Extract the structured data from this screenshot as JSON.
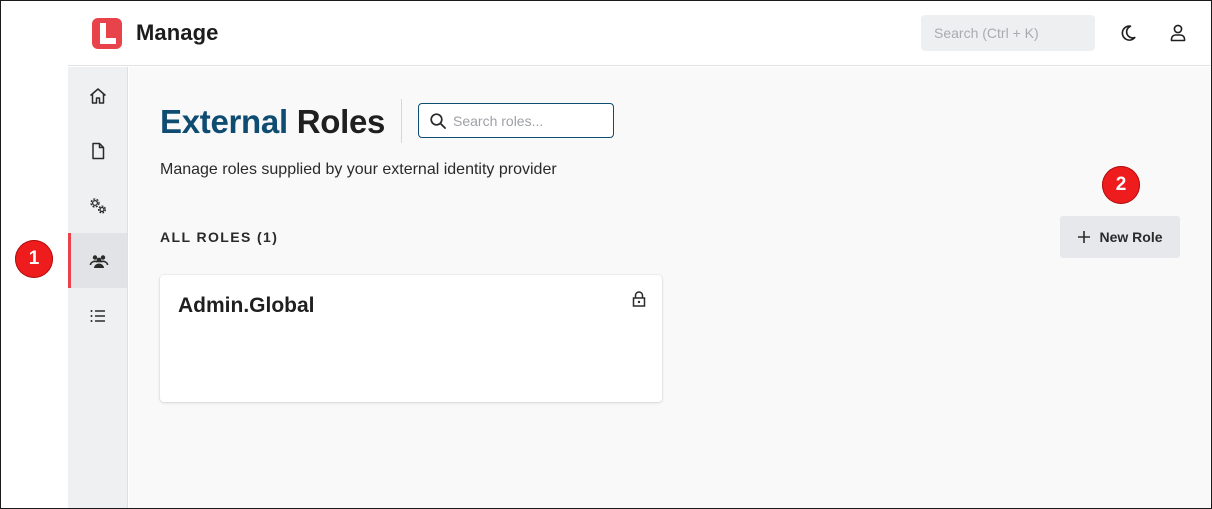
{
  "header": {
    "app_title": "Manage",
    "search_placeholder": "Search (Ctrl + K)"
  },
  "sidebar": {
    "items": [
      {
        "icon": "home-icon"
      },
      {
        "icon": "document-icon"
      },
      {
        "icon": "settings-gears-icon"
      },
      {
        "icon": "users-icon",
        "active": true
      },
      {
        "icon": "list-icon"
      }
    ]
  },
  "main": {
    "title_accent": "External",
    "title_rest": "Roles",
    "search_placeholder": "Search roles...",
    "subtitle": "Manage roles supplied by your external identity provider",
    "section_label": "ALL ROLES (1)",
    "new_role_label": "New Role",
    "roles": [
      {
        "name": "Admin.Global",
        "locked": true
      }
    ]
  },
  "callouts": [
    "1",
    "2"
  ],
  "colors": {
    "brand": "#e8434b",
    "title_accent": "#0f4c72",
    "callout": "#ee1c1c"
  }
}
